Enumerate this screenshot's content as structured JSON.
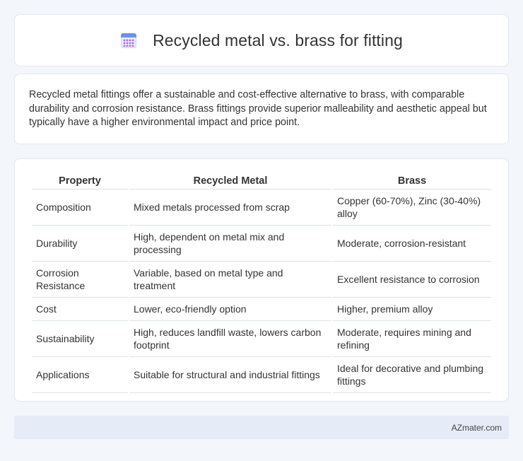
{
  "header": {
    "icon": "calendar-icon",
    "title": "Recycled metal vs. brass for fitting"
  },
  "summary": {
    "text": "Recycled metal fittings offer a sustainable and cost-effective alternative to brass, with comparable durability and corrosion resistance. Brass fittings provide superior malleability and aesthetic appeal but typically have a higher environmental impact and price point."
  },
  "table": {
    "headers": [
      "Property",
      "Recycled Metal",
      "Brass"
    ],
    "rows": [
      [
        "Composition",
        "Mixed metals processed from scrap",
        "Copper (60-70%), Zinc (30-40%) alloy"
      ],
      [
        "Durability",
        "High, dependent on metal mix and processing",
        "Moderate, corrosion-resistant"
      ],
      [
        "Corrosion Resistance",
        "Variable, based on metal type and treatment",
        "Excellent resistance to corrosion"
      ],
      [
        "Cost",
        "Lower, eco-friendly option",
        "Higher, premium alloy"
      ],
      [
        "Sustainability",
        "High, reduces landfill waste, lowers carbon footprint",
        "Moderate, requires mining and refining"
      ],
      [
        "Applications",
        "Suitable for structural and industrial fittings",
        "Ideal for decorative and plumbing fittings"
      ]
    ]
  },
  "footer": {
    "text": "AZmater.com"
  }
}
